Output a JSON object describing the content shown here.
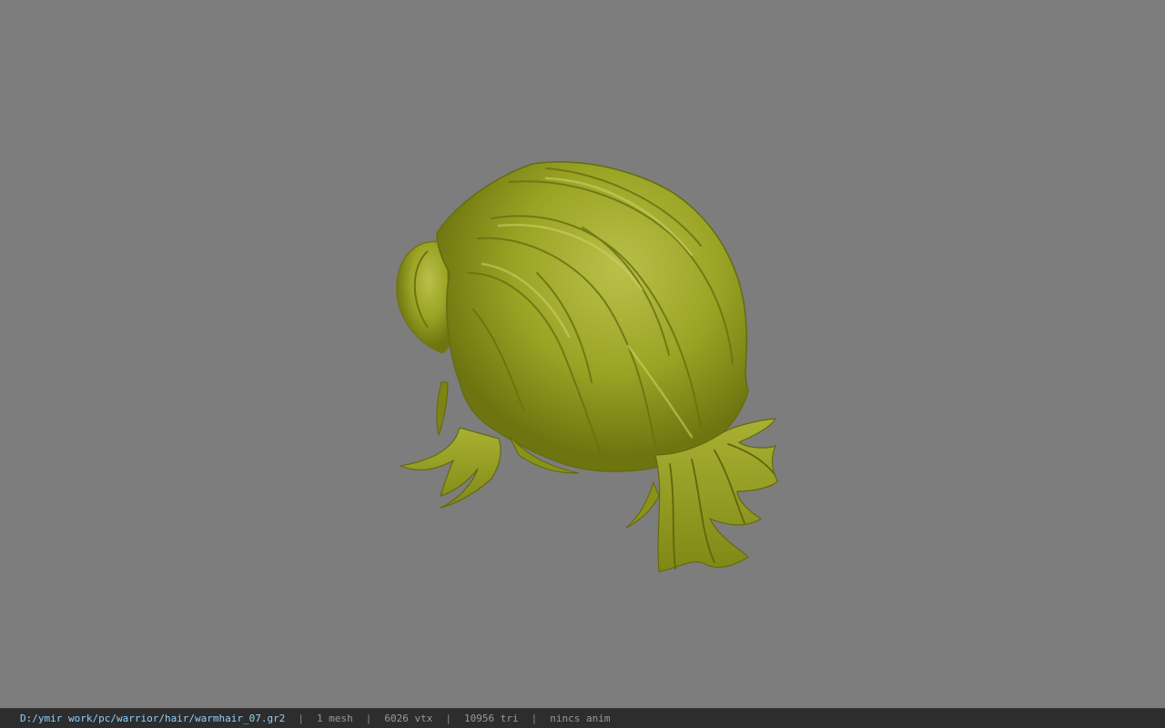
{
  "viewer": {
    "background_color": "#7d7d7d",
    "model": {
      "object": "hair mesh",
      "base_color": "#9aa424",
      "shadow_color": "#6e7510",
      "highlight_color": "#c9cf5a"
    }
  },
  "statusbar": {
    "file_path": "D:/ymir work/pc/warrior/hair/warmhair_07.gr2",
    "separator": "|",
    "mesh_count": "1 mesh",
    "vertex_count": "6026 vtx",
    "triangle_count": "10956 tri",
    "anim_info": "nincs anim"
  }
}
